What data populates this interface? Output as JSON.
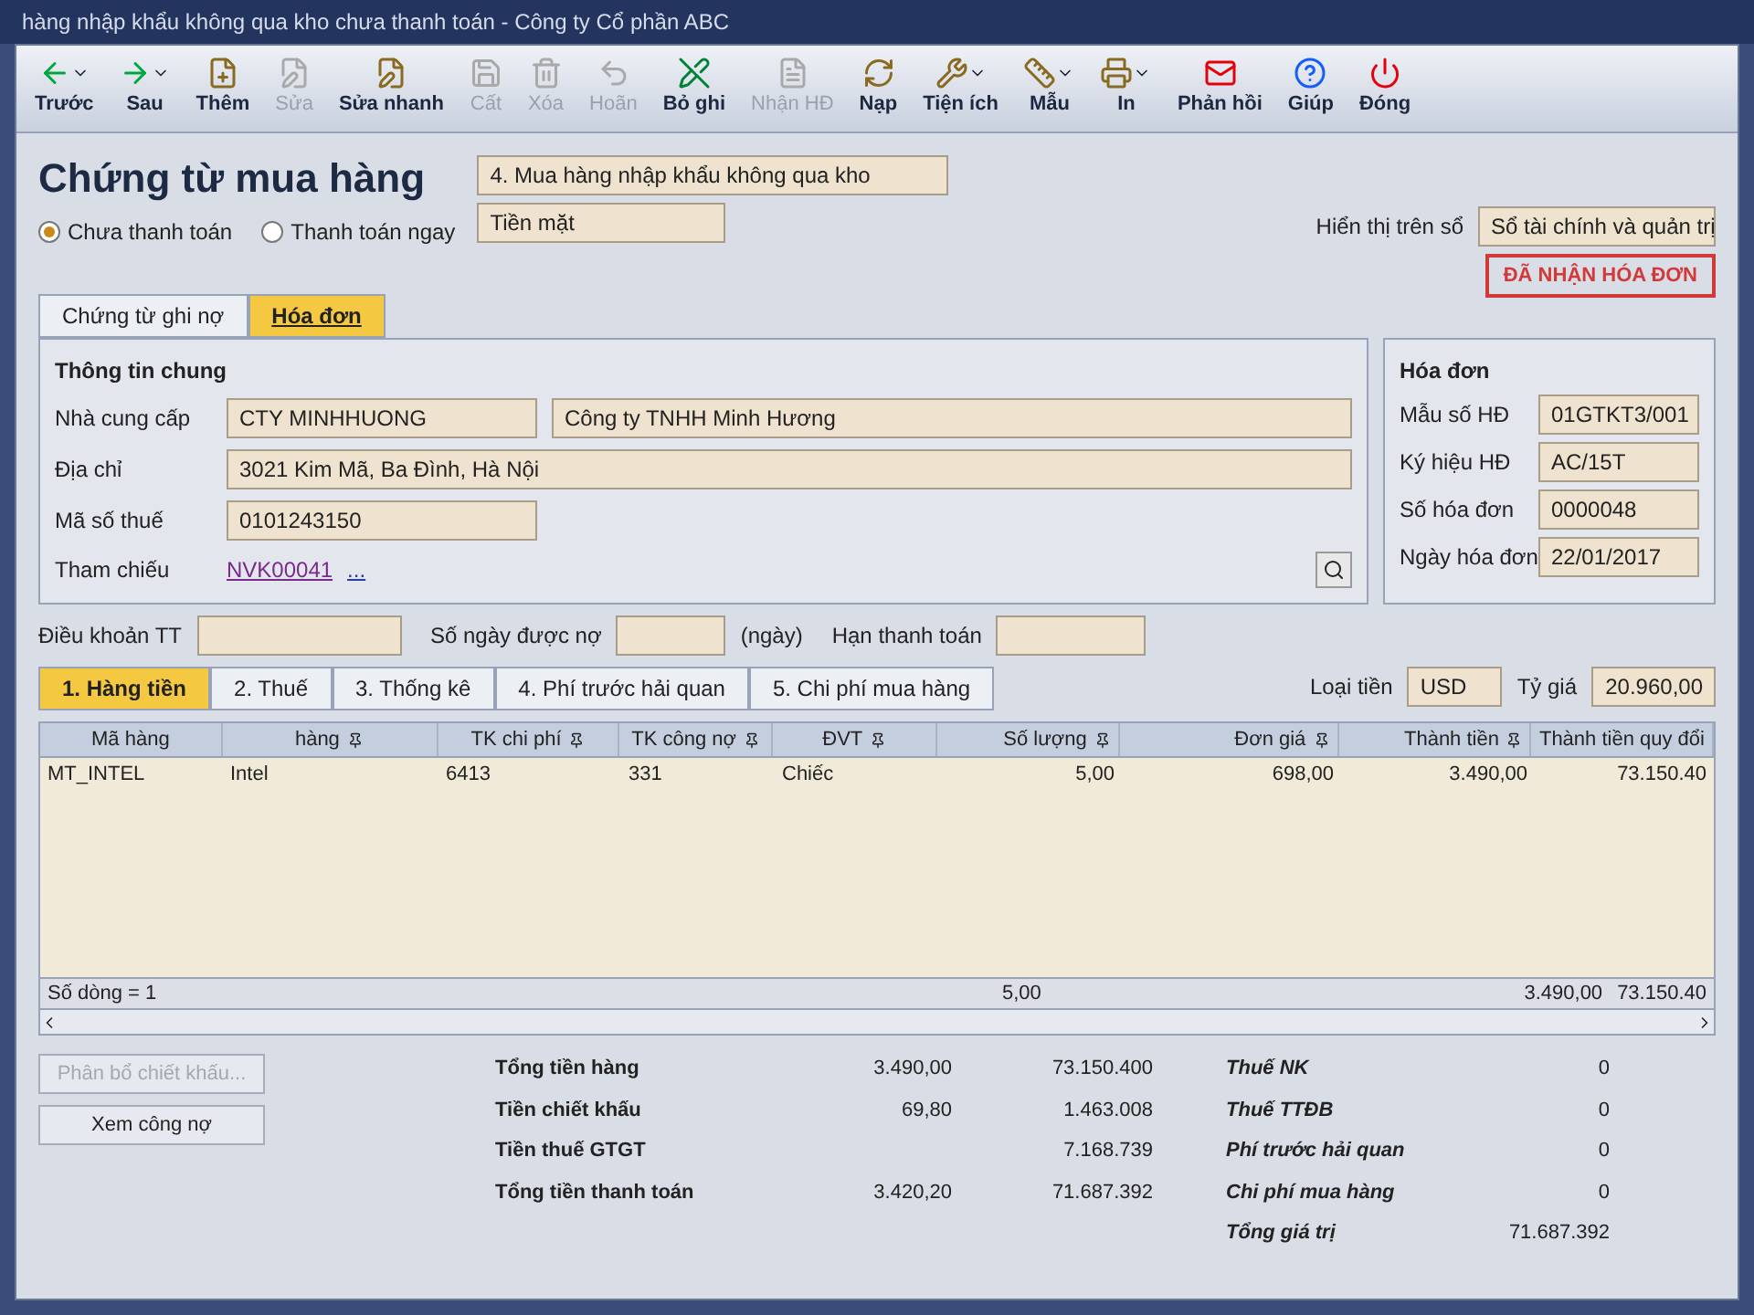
{
  "window": {
    "title": "hàng nhập khẩu không qua kho chưa thanh toán - Công ty Cổ phần ABC"
  },
  "toolbar": [
    {
      "label": "Trước",
      "disabled": false,
      "dropdown": true
    },
    {
      "label": "Sau",
      "disabled": false,
      "dropdown": true
    },
    {
      "label": "Thêm",
      "disabled": false,
      "dropdown": false
    },
    {
      "label": "Sửa",
      "disabled": true,
      "dropdown": false
    },
    {
      "label": "Sửa nhanh",
      "disabled": false,
      "dropdown": false
    },
    {
      "label": "Cất",
      "disabled": true,
      "dropdown": false
    },
    {
      "label": "Xóa",
      "disabled": true,
      "dropdown": false
    },
    {
      "label": "Hoãn",
      "disabled": true,
      "dropdown": false
    },
    {
      "label": "Bỏ ghi",
      "disabled": false,
      "dropdown": false
    },
    {
      "label": "Nhận HĐ",
      "disabled": true,
      "dropdown": false
    },
    {
      "label": "Nạp",
      "disabled": false,
      "dropdown": false
    },
    {
      "label": "Tiện ích",
      "disabled": false,
      "dropdown": true
    },
    {
      "label": "Mẫu",
      "disabled": false,
      "dropdown": true
    },
    {
      "label": "In",
      "disabled": false,
      "dropdown": true
    },
    {
      "label": "Phản hồi",
      "disabled": false,
      "dropdown": false
    },
    {
      "label": "Giúp",
      "disabled": false,
      "dropdown": false
    },
    {
      "label": "Đóng",
      "disabled": false,
      "dropdown": false
    }
  ],
  "heading": "Chứng từ mua hàng",
  "voucher_type": "4. Mua hàng nhập khẩu không qua kho",
  "payment_options": [
    {
      "label": "Chưa thanh toán",
      "selected": true
    },
    {
      "label": "Thanh toán ngay",
      "selected": false
    }
  ],
  "payment_method": "Tiền mặt",
  "ledger": {
    "label": "Hiển thị trên sổ",
    "value": "Sổ tài chính và quản trị"
  },
  "status_badge": "ĐÃ NHẬN HÓA ĐƠN",
  "doc_tabs": [
    {
      "label": "Chứng từ ghi nợ",
      "selected": false
    },
    {
      "label": "Hóa đơn",
      "selected": true
    }
  ],
  "general": {
    "title": "Thông tin chung",
    "supplier": {
      "label": "Nhà cung cấp",
      "code": "CTY MINHHUONG",
      "name": "Công ty TNHH Minh Hương"
    },
    "address": {
      "label": "Địa chỉ",
      "value": "3021 Kim Mã, Ba Đình, Hà Nội"
    },
    "tax_code": {
      "label": "Mã số thuế",
      "value": "0101243150"
    },
    "reference": {
      "label": "Tham chiếu",
      "value": "NVK00041",
      "more": "..."
    }
  },
  "invoice": {
    "title": "Hóa đơn",
    "fields": [
      {
        "label": "Mẫu số HĐ",
        "value": "01GTKT3/001"
      },
      {
        "label": "Ký hiệu HĐ",
        "value": "AC/15T"
      },
      {
        "label": "Số hóa đơn",
        "value": "0000048"
      },
      {
        "label": "Ngày hóa đơn",
        "value": "22/01/2017"
      }
    ]
  },
  "terms": {
    "payment_terms": "Điều khoản TT",
    "credit_days": "Số ngày được nợ",
    "days_unit": "(ngày)",
    "due_date": "Hạn thanh toán"
  },
  "detail_tabs": [
    {
      "label": "1. Hàng tiền",
      "selected": true
    },
    {
      "label": "2. Thuế",
      "selected": false
    },
    {
      "label": "3. Thống kê",
      "selected": false
    },
    {
      "label": "4. Phí trước hải quan",
      "selected": false
    },
    {
      "label": "5. Chi phí mua hàng",
      "selected": false
    }
  ],
  "currency": {
    "label": "Loại tiền",
    "value": "USD",
    "rate_label": "Tỷ giá",
    "rate": "20.960,00"
  },
  "table": {
    "columns": [
      "Mã hàng",
      "hàng",
      "TK chi phí",
      "TK công nợ",
      "ĐVT",
      "Số lượng",
      "Đơn giá",
      "Thành tiền",
      "Thành tiền quy đổi"
    ],
    "rows": [
      [
        "MT_INTEL",
        "Intel",
        "6413",
        "331",
        "Chiếc",
        "5,00",
        "698,00",
        "3.490,00",
        "73.150.40"
      ]
    ],
    "footer": {
      "count": "Số dòng = 1",
      "quantity": "5,00",
      "amount": "3.490,00",
      "converted": "73.150.40"
    }
  },
  "buttons": [
    {
      "label": "Phân bổ chiết khấu...",
      "disabled": true
    },
    {
      "label": "Xem công nợ",
      "disabled": false
    }
  ],
  "totals": [
    {
      "label": "Tổng tiền hàng",
      "amount": "3.490,00",
      "converted": "73.150.400"
    },
    {
      "label": "Tiền chiết khấu",
      "amount": "69,80",
      "converted": "1.463.008"
    },
    {
      "label": "Tiền thuế GTGT",
      "converted": "7.168.739"
    },
    {
      "label": "Tổng tiền thanh toán",
      "amount": "3.420,20",
      "converted": "71.687.392"
    }
  ],
  "costs": [
    {
      "label": "Thuế NK",
      "value": "0"
    },
    {
      "label": "Thuế TTĐB",
      "value": "0"
    },
    {
      "label": "Phí trước hải quan",
      "value": "0"
    },
    {
      "label": "Chi phí mua hàng",
      "value": "0"
    },
    {
      "label": "Tổng giá trị",
      "value": "71.687.392"
    }
  ]
}
